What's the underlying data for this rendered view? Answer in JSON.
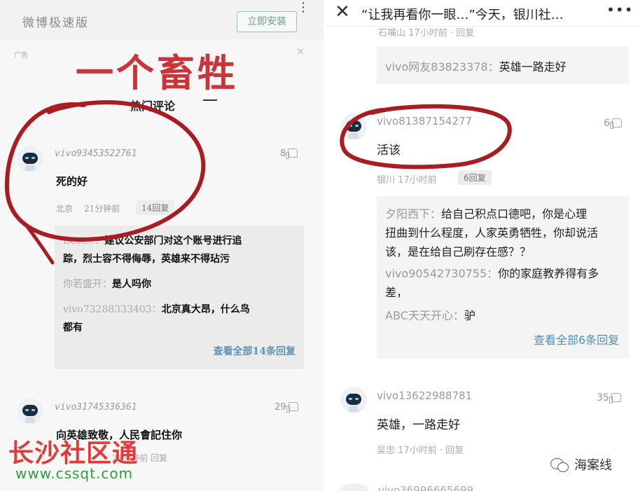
{
  "left": {
    "app_name": "微博极速版",
    "install_label": "立即安装",
    "menu_icon": "⋮",
    "ad_label": "广告",
    "ad_close": "×",
    "overlay_title": "一个畜牲",
    "hot_comments_title": "热门评论",
    "comment1": {
      "user": "vivo93453522761",
      "text": "死的好",
      "location": "北京",
      "time": "21分钟前",
      "replies": "14回复",
      "likes": "8"
    },
    "reply_box": {
      "lines": [
        {
          "name": "Best…：",
          "text": "建议公安部门对这个账号进行追"
        },
        {
          "name": "",
          "text": "踪，烈士容不得侮辱，英雄来不得玷污"
        },
        {
          "name": "你若盛开：",
          "text": "是人吗你"
        },
        {
          "name": "vivo73288333403：",
          "text": "北京真大昂，什么鸟"
        },
        {
          "name": "",
          "text": "都有"
        }
      ],
      "view_all": "查看全部14条回复"
    },
    "comment2": {
      "user": "vivo31745336361",
      "text": "向英雄致敬，人民會記住你",
      "meta": "21分钟前",
      "reply": "回复",
      "likes": "29"
    },
    "watermark": "长沙社区通",
    "watermark_url": "www.cssqt.com"
  },
  "right": {
    "close_icon": "✕",
    "nav_title": "“让我再看你一眼…”今天，银川社…",
    "more_icon": "•••",
    "cut_top_text": "石嘴山  17小时前 · 回复",
    "quote1": {
      "name": "vivo网友83823378：",
      "text": "英雄一路走好"
    },
    "comment1": {
      "user": "vivo81387154277",
      "text": "活该",
      "meta": "银川  17小时前",
      "replies": "6回复",
      "likes": "6"
    },
    "reply_box": {
      "lines": [
        {
          "name": "夕阳西下：",
          "text": "给自己积点口德吧，你是心理"
        },
        {
          "name": "",
          "text": "扭曲到什么程度，人家英勇牺牲，你却说活"
        },
        {
          "name": "",
          "text": "该，是在给自己刷存在感？？"
        },
        {
          "name": "vivo90542730755：",
          "text": "你的家庭教养得有多"
        },
        {
          "name": "",
          "text": "差，"
        },
        {
          "name": "ABC天天开心：",
          "text": "驴"
        }
      ],
      "view_all": "查看全部6条回复"
    },
    "comment2": {
      "user": "vivo13622988781",
      "text": "英雄，一路走好",
      "meta": "吴忠  17小时前 · 回复",
      "likes": "35"
    },
    "footer_brand": "海案线",
    "cut_bottom_text": "vivo36996665699"
  },
  "colors": {
    "annotation_red": "#a81c22",
    "overlay_red": "#c9363a",
    "link_blue": "#4b8fc0",
    "watermark_red": "#e23a3a",
    "watermark_green": "#2f9d3a"
  }
}
